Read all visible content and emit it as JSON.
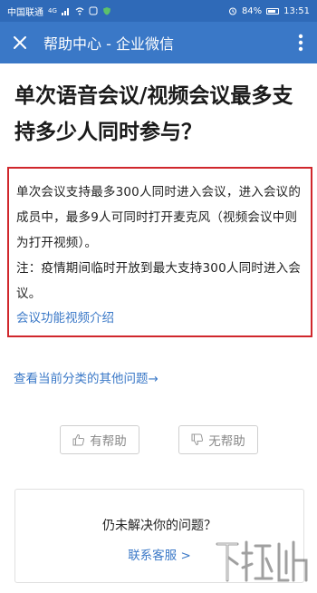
{
  "status_bar": {
    "carrier": "中国联通",
    "signal": "4G",
    "battery": "84%",
    "time": "13:51"
  },
  "app_bar": {
    "title": "帮助中心 - 企业微信",
    "close_icon": "close-icon",
    "more_icon": "more-vertical-icon"
  },
  "article": {
    "title": "单次语音会议/视频会议最多支持多少人同时参与？",
    "answer": "单次会议支持最多300人同时进入会议，进入会议的成员中，最多9人可同时打开麦克风（视频会议中则为打开视频）。\n注：疫情期间临时开放到最大支持300人同时进入会议。",
    "answer_link": "会议功能视频介绍",
    "highlight_color": "#d0272c"
  },
  "more_questions": "查看当前分类的其他问题→",
  "feedback": {
    "helpful": "有帮助",
    "unhelpful": "无帮助",
    "helpful_icon": "thumbs-up-icon",
    "unhelpful_icon": "thumbs-down-icon"
  },
  "help_card": {
    "question": "仍未解决你的问题？",
    "contact": "联系客服 >"
  },
  "colors": {
    "app_bar": "#3a78c7",
    "link": "#3a78c7",
    "border": "#d0272c"
  }
}
